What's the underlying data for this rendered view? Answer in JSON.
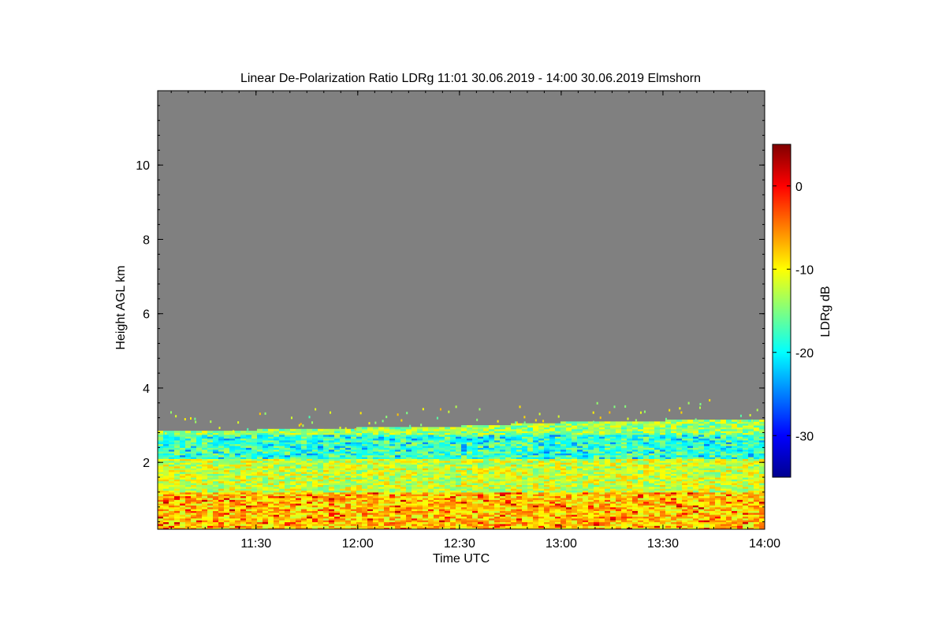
{
  "chart_data": {
    "type": "heatmap",
    "title": "Linear De-Polarization Ratio LDRg   11:01 30.06.2019 - 14:00 30.06.2019 Elmshorn",
    "xlabel": "Time UTC",
    "ylabel": "Height AGL km",
    "x_range": [
      "11:01",
      "14:00"
    ],
    "x_ticks": [
      "11:30",
      "12:00",
      "12:30",
      "13:00",
      "13:30",
      "14:00"
    ],
    "ylim": [
      0.2,
      12
    ],
    "y_ticks": [
      2,
      4,
      6,
      8,
      10
    ],
    "no_data_color": "#808080",
    "colorbar": {
      "label": "LDRg dB",
      "range": [
        -35,
        5
      ],
      "ticks": [
        0,
        -10,
        -20,
        -30
      ],
      "colormap": "jet"
    },
    "signal_top_km": [
      {
        "time": "11:01",
        "height": 2.8
      },
      {
        "time": "11:30",
        "height": 2.85
      },
      {
        "time": "12:00",
        "height": 2.9
      },
      {
        "time": "12:30",
        "height": 2.95
      },
      {
        "time": "13:00",
        "height": 3.05
      },
      {
        "time": "13:30",
        "height": 3.1
      },
      {
        "time": "14:00",
        "height": 3.15
      }
    ],
    "layers": [
      {
        "height_from": 0.2,
        "height_to": 1.2,
        "ldr_db": -8
      },
      {
        "height_from": 1.2,
        "height_to": 2.1,
        "ldr_db": -12
      },
      {
        "height_from": 2.1,
        "height_to": 2.7,
        "ldr_db": -17
      },
      {
        "height_from": 2.7,
        "height_to": 3.1,
        "ldr_db": -14
      }
    ],
    "grid": false,
    "legend": "colorbar-right"
  }
}
